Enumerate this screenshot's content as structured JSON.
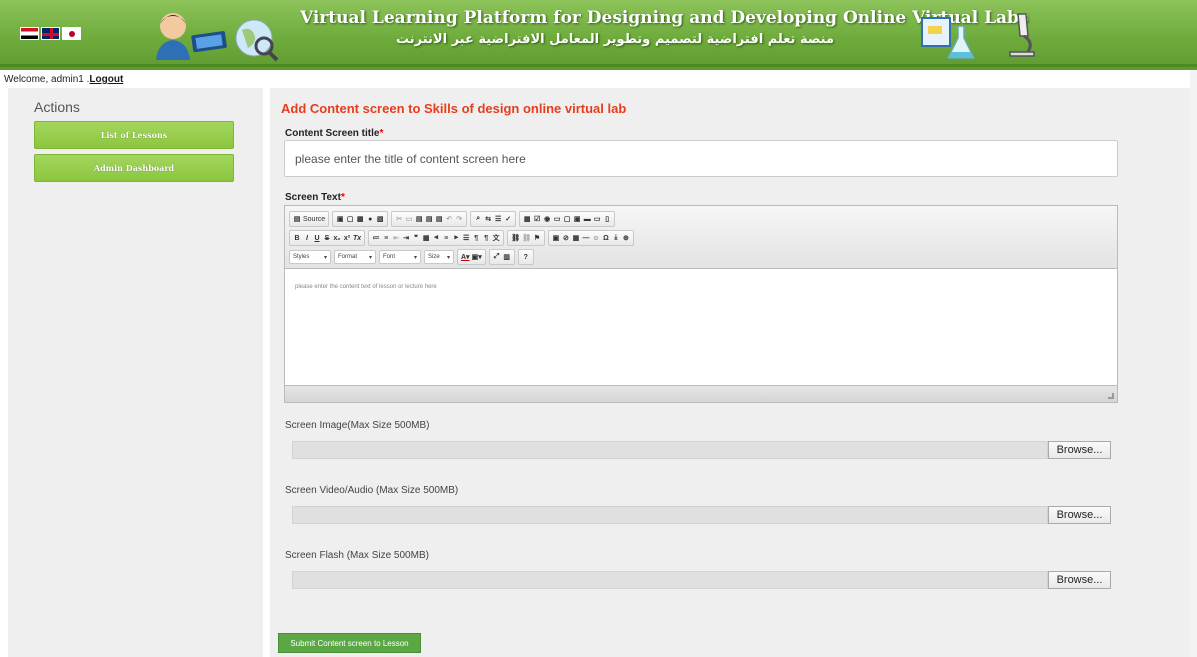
{
  "header": {
    "title": "Virtual Learning Platform for Designing and Developing Online Virtual Labs",
    "subtitle": "منصة تعلم افتراضية لتصميم وتطوير المعامل الافتراضية عبر الانترنت",
    "language_flags": [
      "egypt-flag-icon",
      "uk-flag-icon",
      "japan-flag-icon"
    ]
  },
  "user": {
    "welcome_text": "Welcome, admin1 .",
    "logout_label": "Logout"
  },
  "sidebar": {
    "title": "Actions",
    "items": [
      {
        "label": "List of Lessons"
      },
      {
        "label": "Admin Dashboard"
      }
    ]
  },
  "form": {
    "page_title": "Add Content screen to Skills of design online virtual lab",
    "title_label": "Content Screen title",
    "title_placeholder": "please enter the title of content screen here",
    "text_label": "Screen Text",
    "required_mark": "*",
    "editor": {
      "source_label": "Source",
      "styles_label": "Styles",
      "format_label": "Format",
      "font_label": "Font",
      "size_label": "Size",
      "placeholder": "please enter the content text of lesson or lecture here"
    },
    "image_label": "Screen Image(Max Size 500MB)",
    "video_label": "Screen Video/Audio (Max Size 500MB)",
    "flash_label": "Screen Flash (Max Size 500MB)",
    "browse_label": "Browse...",
    "submit_label": "Submit Content screen to Lesson"
  },
  "colors": {
    "header_green": "#6fab3c",
    "page_title": "#e63d1f",
    "sidebar_button": "#8cc63f",
    "submit_button": "#5ca745"
  }
}
